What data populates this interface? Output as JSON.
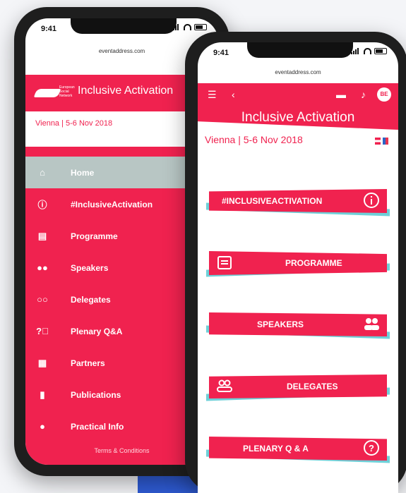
{
  "left_phone": {
    "time": "9:41",
    "url": "eventaddress.com",
    "logo_text": "European Social Network",
    "title": "Inclusive Activation",
    "city_date": "Vienna | 5-6 Nov 2018",
    "menu": [
      {
        "label": "Home",
        "icon": "home-icon"
      },
      {
        "label": "#InclusiveActivation",
        "icon": "info-icon"
      },
      {
        "label": "Programme",
        "icon": "calendar-icon"
      },
      {
        "label": "Speakers",
        "icon": "people-icon"
      },
      {
        "label": "Delegates",
        "icon": "people-outline-icon"
      },
      {
        "label": "Plenary Q&A",
        "icon": "question-icon"
      },
      {
        "label": "Partners",
        "icon": "building-icon"
      },
      {
        "label": "Publications",
        "icon": "document-icon"
      },
      {
        "label": "Practical Info",
        "icon": "info-filled-icon"
      }
    ],
    "terms": "Terms & Conditions"
  },
  "right_phone": {
    "time": "9:41",
    "url": "eventaddress.com",
    "avatar": "BE",
    "title": "Inclusive Activation",
    "city_date": "Vienna | 5-6 Nov 2018",
    "tiles": [
      {
        "label": "#INCLUSIVEACTIVATION",
        "icon": "info-icon"
      },
      {
        "label": "PROGRAMME",
        "icon": "calendar-icon"
      },
      {
        "label": "SPEAKERS",
        "icon": "people-icon"
      },
      {
        "label": "DELEGATES",
        "icon": "people-outline-icon"
      },
      {
        "label": "PLENARY Q & A",
        "icon": "question-icon"
      }
    ]
  },
  "colors": {
    "brand": "#f0224f",
    "home_highlight": "#b8c6c4",
    "accent_cyan": "#6ed0d8"
  }
}
